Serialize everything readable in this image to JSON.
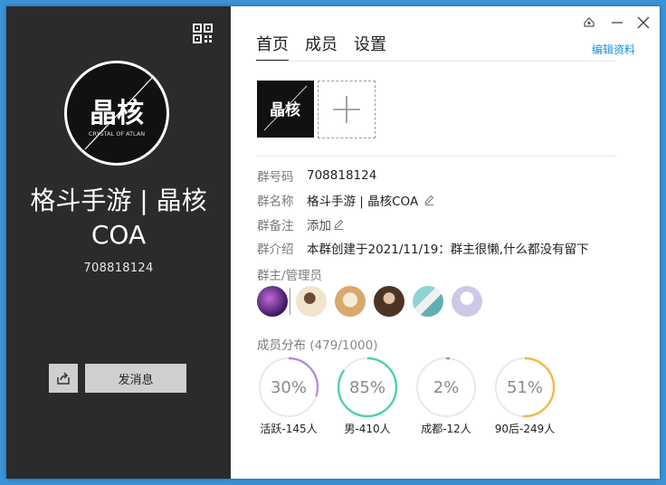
{
  "left_panel": {
    "group_name": "格斗手游 | 晶核COA",
    "group_number": "708818124",
    "send_message_label": "发消息",
    "logo_text": "晶核",
    "logo_subtext": "CRYSTAL OF ATLAN"
  },
  "tabs": [
    {
      "label": "首页",
      "active": true
    },
    {
      "label": "成员",
      "active": false
    },
    {
      "label": "设置",
      "active": false
    }
  ],
  "edit_profile_label": "编辑资料",
  "info": {
    "number_label": "群号码",
    "number_value": "708818124",
    "name_label": "群名称",
    "name_value": "格斗手游 | 晶核COA",
    "remark_label": "群备注",
    "remark_value": "添加",
    "intro_label": "群介绍",
    "intro_value": "本群创建于2021/11/19：群主很懒,什么都没有留下"
  },
  "admins_label": "群主/管理员",
  "admins": [
    {
      "name": "owner",
      "color": "#5b2a86"
    },
    {
      "name": "admin-1",
      "color": "#d8b48a"
    },
    {
      "name": "admin-2",
      "color": "#e8c89a"
    },
    {
      "name": "admin-3",
      "color": "#7a5540"
    },
    {
      "name": "admin-4",
      "color": "#7fc9c9"
    },
    {
      "name": "admin-5",
      "color": "#d7d2e6"
    }
  ],
  "distribution": {
    "label": "成员分布",
    "count_text": "(479/1000)",
    "items": [
      {
        "percent": 30,
        "percent_text": "30%",
        "caption": "活跃-145人",
        "color": "#b48ee0"
      },
      {
        "percent": 85,
        "percent_text": "85%",
        "caption": "男-410人",
        "color": "#4fd1a8"
      },
      {
        "percent": 2,
        "percent_text": "2%",
        "caption": "成都-12人",
        "color": "#5aa9e6"
      },
      {
        "percent": 51,
        "percent_text": "51%",
        "caption": "90后-249人",
        "color": "#f2b94a"
      }
    ]
  },
  "colors": {
    "left_bg": "#2b2b2b",
    "link": "#1d8fd6",
    "window_border": "#3a93d6"
  }
}
